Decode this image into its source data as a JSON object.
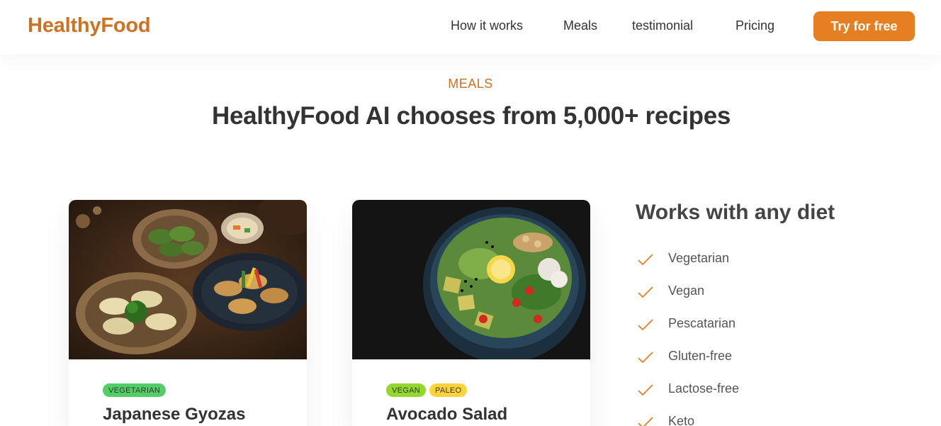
{
  "header": {
    "logo": "HealthyFood",
    "nav": [
      "How it works",
      "Meals",
      "testimonial",
      "Pricing"
    ],
    "cta": "Try for free",
    "accent_color": "#e67e22"
  },
  "section": {
    "tag": "MEALS",
    "title": "HealthyFood AI chooses from 5,000+ recipes"
  },
  "meals": [
    {
      "tags": [
        "VEGETARIAN"
      ],
      "title": "Japanese Gyozas",
      "image_icon": "gyoza-plate-image"
    },
    {
      "tags": [
        "VEGAN",
        "PALEO"
      ],
      "title": "Avocado Salad",
      "image_icon": "salad-bowl-image"
    }
  ],
  "diets": {
    "title": "Works with any diet",
    "items": [
      "Vegetarian",
      "Vegan",
      "Pescatarian",
      "Gluten-free",
      "Lactose-free",
      "Keto"
    ],
    "icon": "checkmark-icon"
  }
}
